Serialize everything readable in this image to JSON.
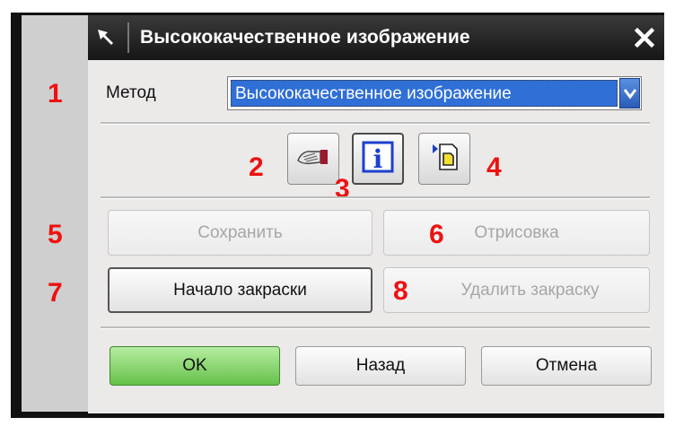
{
  "window": {
    "title": "Высококачественное изображение",
    "title_icon": "pin-icon",
    "close_icon": "close-icon"
  },
  "method": {
    "label": "Метод",
    "value": "Высококачественное изображение",
    "arrow_icon": "chevron-down-icon"
  },
  "markers": [
    "1",
    "2",
    "3",
    "4",
    "5",
    "6",
    "7",
    "8"
  ],
  "tools": [
    {
      "icon": "hand-point-icon"
    },
    {
      "icon": "info-icon",
      "glyph": "i"
    },
    {
      "icon": "export-image-icon"
    }
  ],
  "buttons": {
    "save": "Сохранить",
    "render": "Отрисовка",
    "start_shading": "Начало закраски",
    "delete_shading": "Удалить закраску",
    "ok": "OK",
    "back": "Назад",
    "cancel": "Отмена"
  },
  "colors": {
    "marker": "#ee1111",
    "select_highlight": "#2f6fd6",
    "ok_button": "#66c14a"
  }
}
